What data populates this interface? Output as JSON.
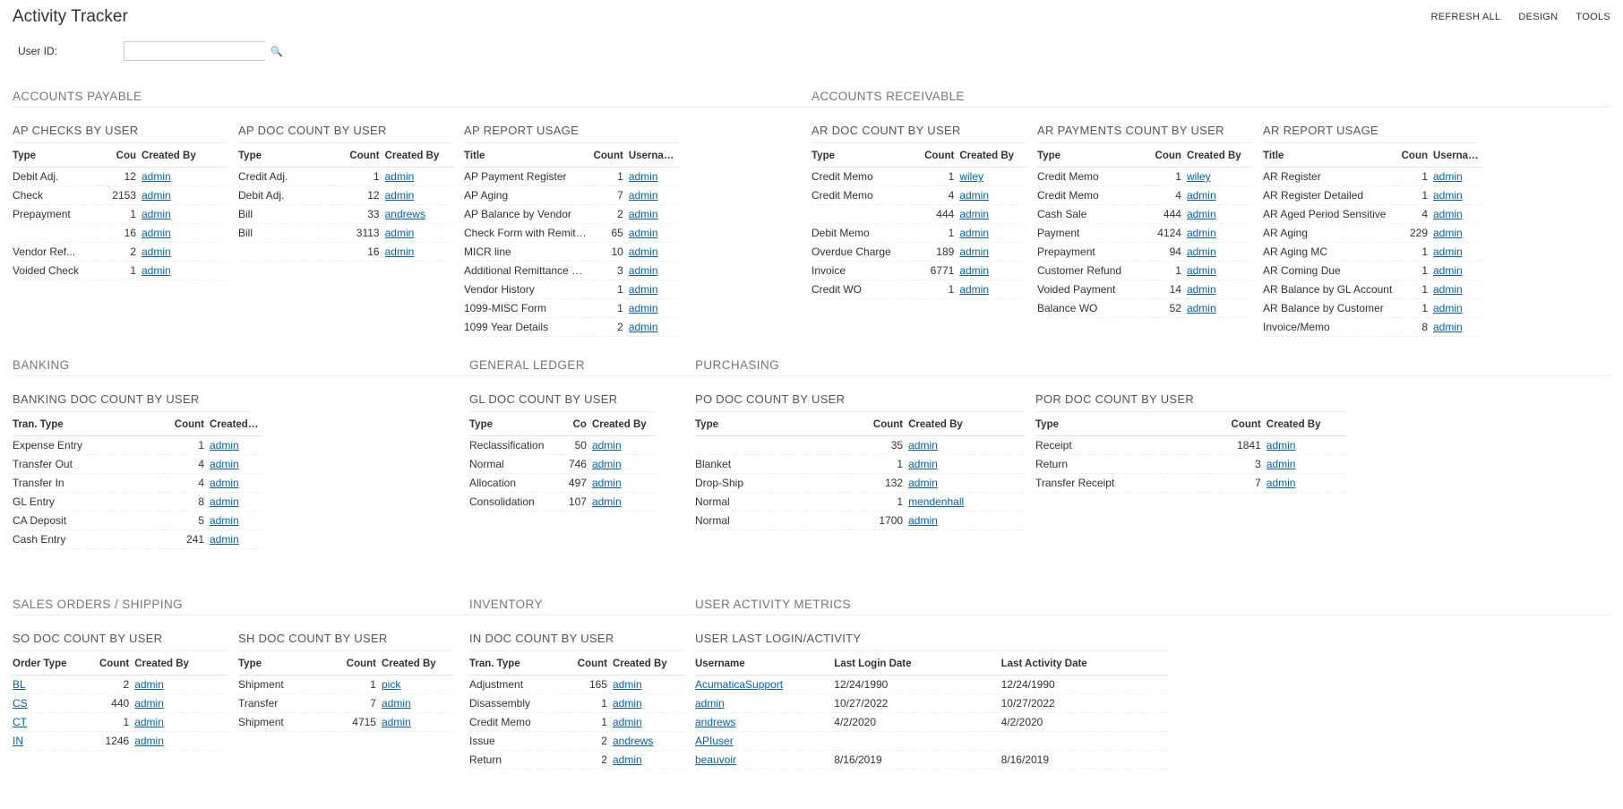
{
  "header": {
    "title": "Activity Tracker",
    "actions": {
      "refresh": "REFRESH ALL",
      "design": "DESIGN",
      "tools": "TOOLS"
    }
  },
  "filter": {
    "label": "User ID:",
    "value": ""
  },
  "sections": {
    "ap": "ACCOUNTS PAYABLE",
    "ar": "ACCOUNTS RECEIVABLE",
    "banking": "BANKING",
    "gl": "GENERAL LEDGER",
    "purchasing": "PURCHASING",
    "sales": "SALES ORDERS / SHIPPING",
    "inventory": "INVENTORY",
    "usermetrics": "USER ACTIVITY METRICS"
  },
  "widgets": {
    "ap_checks": {
      "title": "AP CHECKS BY USER",
      "cols": {
        "c1": "Type",
        "c2": "Cou",
        "c3": "Created By"
      },
      "rows": [
        {
          "c1": "Debit Adj.",
          "c2": "12",
          "c3": "admin"
        },
        {
          "c1": "Check",
          "c2": "2153",
          "c3": "admin"
        },
        {
          "c1": "Prepayment",
          "c2": "1",
          "c3": "admin"
        },
        {
          "c1": "",
          "c2": "16",
          "c3": "admin"
        },
        {
          "c1": "Vendor Ref...",
          "c2": "2",
          "c3": "admin"
        },
        {
          "c1": "Voided Check",
          "c2": "1",
          "c3": "admin"
        }
      ]
    },
    "ap_doc": {
      "title": "AP DOC COUNT BY USER",
      "cols": {
        "c1": "Type",
        "c2": "Count",
        "c3": "Created By"
      },
      "rows": [
        {
          "c1": "Credit Adj.",
          "c2": "1",
          "c3": "admin"
        },
        {
          "c1": "Debit Adj.",
          "c2": "12",
          "c3": "admin"
        },
        {
          "c1": "Bill",
          "c2": "33",
          "c3": "andrews"
        },
        {
          "c1": "Bill",
          "c2": "3113",
          "c3": "admin"
        },
        {
          "c1": "",
          "c2": "16",
          "c3": "admin"
        }
      ]
    },
    "ap_report": {
      "title": "AP REPORT USAGE",
      "cols": {
        "c1": "Title",
        "c2": "Count",
        "c3": "Username"
      },
      "rows": [
        {
          "c1": "AP Payment Register",
          "c2": "1",
          "c3": "admin"
        },
        {
          "c1": "AP Aging",
          "c2": "7",
          "c3": "admin"
        },
        {
          "c1": "AP Balance by Vendor",
          "c2": "2",
          "c3": "admin"
        },
        {
          "c1": "Check Form with Remitta...",
          "c2": "65",
          "c3": "admin"
        },
        {
          "c1": "MICR line",
          "c2": "10",
          "c3": "admin"
        },
        {
          "c1": "Additional Remittance Fo...",
          "c2": "3",
          "c3": "admin"
        },
        {
          "c1": "Vendor History",
          "c2": "1",
          "c3": "admin"
        },
        {
          "c1": "1099-MISC Form",
          "c2": "1",
          "c3": "admin"
        },
        {
          "c1": "1099 Year Details",
          "c2": "2",
          "c3": "admin"
        }
      ]
    },
    "ar_doc": {
      "title": "AR DOC COUNT BY USER",
      "cols": {
        "c1": "Type",
        "c2": "Count",
        "c3": "Created By"
      },
      "rows": [
        {
          "c1": "Credit Memo",
          "c2": "1",
          "c3": "wiley"
        },
        {
          "c1": "Credit Memo",
          "c2": "4",
          "c3": "admin"
        },
        {
          "c1": "",
          "c2": "444",
          "c3": "admin"
        },
        {
          "c1": "Debit Memo",
          "c2": "1",
          "c3": "admin"
        },
        {
          "c1": "Overdue Charge",
          "c2": "189",
          "c3": "admin"
        },
        {
          "c1": "Invoice",
          "c2": "6771",
          "c3": "admin"
        },
        {
          "c1": "Credit WO",
          "c2": "1",
          "c3": "admin"
        }
      ]
    },
    "ar_pay": {
      "title": "AR PAYMENTS COUNT BY USER",
      "cols": {
        "c1": "Type",
        "c2": "Coun",
        "c3": "Created By"
      },
      "rows": [
        {
          "c1": "Credit Memo",
          "c2": "1",
          "c3": "wiley"
        },
        {
          "c1": "Credit Memo",
          "c2": "4",
          "c3": "admin"
        },
        {
          "c1": "Cash Sale",
          "c2": "444",
          "c3": "admin"
        },
        {
          "c1": "Payment",
          "c2": "4124",
          "c3": "admin"
        },
        {
          "c1": "Prepayment",
          "c2": "94",
          "c3": "admin"
        },
        {
          "c1": "Customer Refund",
          "c2": "1",
          "c3": "admin"
        },
        {
          "c1": "Voided Payment",
          "c2": "14",
          "c3": "admin"
        },
        {
          "c1": "Balance WO",
          "c2": "52",
          "c3": "admin"
        }
      ]
    },
    "ar_report": {
      "title": "AR REPORT USAGE",
      "cols": {
        "c1": "Title",
        "c2": "Coun",
        "c3": "Username"
      },
      "rows": [
        {
          "c1": "AR Register",
          "c2": "1",
          "c3": "admin"
        },
        {
          "c1": "AR Register Detailed",
          "c2": "1",
          "c3": "admin"
        },
        {
          "c1": "AR Aged Period Sensitive",
          "c2": "4",
          "c3": "admin"
        },
        {
          "c1": "AR Aging",
          "c2": "229",
          "c3": "admin"
        },
        {
          "c1": "AR Aging MC",
          "c2": "1",
          "c3": "admin"
        },
        {
          "c1": "AR Coming Due",
          "c2": "1",
          "c3": "admin"
        },
        {
          "c1": "AR Balance by GL Account",
          "c2": "1",
          "c3": "admin"
        },
        {
          "c1": "AR Balance by Customer",
          "c2": "1",
          "c3": "admin"
        },
        {
          "c1": "Invoice/Memo",
          "c2": "8",
          "c3": "admin"
        }
      ]
    },
    "bank_doc": {
      "title": "BANKING DOC COUNT BY USER",
      "cols": {
        "c1": "Tran. Type",
        "c2": "Count",
        "c3": "Created By"
      },
      "rows": [
        {
          "c1": "Expense Entry",
          "c2": "1",
          "c3": "admin"
        },
        {
          "c1": "Transfer Out",
          "c2": "4",
          "c3": "admin"
        },
        {
          "c1": "Transfer In",
          "c2": "4",
          "c3": "admin"
        },
        {
          "c1": "GL Entry",
          "c2": "8",
          "c3": "admin"
        },
        {
          "c1": "CA Deposit",
          "c2": "5",
          "c3": "admin"
        },
        {
          "c1": "Cash Entry",
          "c2": "241",
          "c3": "admin"
        }
      ]
    },
    "gl_doc": {
      "title": "GL DOC COUNT BY USER",
      "cols": {
        "c1": "Type",
        "c2": "Co",
        "c3": "Created By"
      },
      "rows": [
        {
          "c1": "Reclassification",
          "c2": "50",
          "c3": "admin"
        },
        {
          "c1": "Normal",
          "c2": "746",
          "c3": "admin"
        },
        {
          "c1": "Allocation",
          "c2": "497",
          "c3": "admin"
        },
        {
          "c1": "Consolidation",
          "c2": "107",
          "c3": "admin"
        }
      ]
    },
    "po_doc": {
      "title": "PO DOC COUNT BY USER",
      "cols": {
        "c1": "Type",
        "c2": "Count",
        "c3": "Created By"
      },
      "rows": [
        {
          "c1": "",
          "c2": "35",
          "c3": "admin"
        },
        {
          "c1": "Blanket",
          "c2": "1",
          "c3": "admin"
        },
        {
          "c1": "Drop-Ship",
          "c2": "132",
          "c3": "admin"
        },
        {
          "c1": "Normal",
          "c2": "1",
          "c3": "mendenhall"
        },
        {
          "c1": "Normal",
          "c2": "1700",
          "c3": "admin"
        }
      ]
    },
    "por_doc": {
      "title": "POR DOC COUNT BY USER",
      "cols": {
        "c1": "Type",
        "c2": "Count",
        "c3": "Created By"
      },
      "rows": [
        {
          "c1": "Receipt",
          "c2": "1841",
          "c3": "admin"
        },
        {
          "c1": "Return",
          "c2": "3",
          "c3": "admin"
        },
        {
          "c1": "Transfer Receipt",
          "c2": "7",
          "c3": "admin"
        }
      ]
    },
    "so_doc": {
      "title": "SO DOC COUNT BY USER",
      "cols": {
        "c1": "Order Type",
        "c2": "Count",
        "c3": "Created By"
      },
      "rows": [
        {
          "c1": "BL",
          "c2": "2",
          "c3": "admin",
          "c1_link": true
        },
        {
          "c1": "CS",
          "c2": "440",
          "c3": "admin",
          "c1_link": true
        },
        {
          "c1": "CT",
          "c2": "1",
          "c3": "admin",
          "c1_link": true
        },
        {
          "c1": "IN",
          "c2": "1246",
          "c3": "admin",
          "c1_link": true
        }
      ]
    },
    "sh_doc": {
      "title": "SH DOC COUNT BY USER",
      "cols": {
        "c1": "Type",
        "c2": "Count",
        "c3": "Created By"
      },
      "rows": [
        {
          "c1": "Shipment",
          "c2": "1",
          "c3": "pick"
        },
        {
          "c1": "Transfer",
          "c2": "7",
          "c3": "admin"
        },
        {
          "c1": "Shipment",
          "c2": "4715",
          "c3": "admin"
        }
      ]
    },
    "in_doc": {
      "title": "IN DOC COUNT BY USER",
      "cols": {
        "c1": "Tran. Type",
        "c2": "Count",
        "c3": "Created By"
      },
      "rows": [
        {
          "c1": "Adjustment",
          "c2": "165",
          "c3": "admin"
        },
        {
          "c1": "Disassembly",
          "c2": "1",
          "c3": "admin"
        },
        {
          "c1": "Credit Memo",
          "c2": "1",
          "c3": "admin"
        },
        {
          "c1": "Issue",
          "c2": "2",
          "c3": "andrews"
        },
        {
          "c1": "Return",
          "c2": "2",
          "c3": "admin"
        }
      ]
    },
    "user_login": {
      "title": "USER LAST LOGIN/ACTIVITY",
      "cols": {
        "c1": "Username",
        "c2": "Last Login Date",
        "c3": "Last Activity Date"
      },
      "rows": [
        {
          "c1": "AcumaticaSupport",
          "c2": "12/24/1990",
          "c3": "12/24/1990"
        },
        {
          "c1": "admin",
          "c2": "10/27/2022",
          "c3": "10/27/2022"
        },
        {
          "c1": "andrews",
          "c2": "4/2/2020",
          "c3": "4/2/2020"
        },
        {
          "c1": "APIuser",
          "c2": "",
          "c3": ""
        },
        {
          "c1": "beauvoir",
          "c2": "8/16/2019",
          "c3": "8/16/2019"
        }
      ]
    }
  }
}
